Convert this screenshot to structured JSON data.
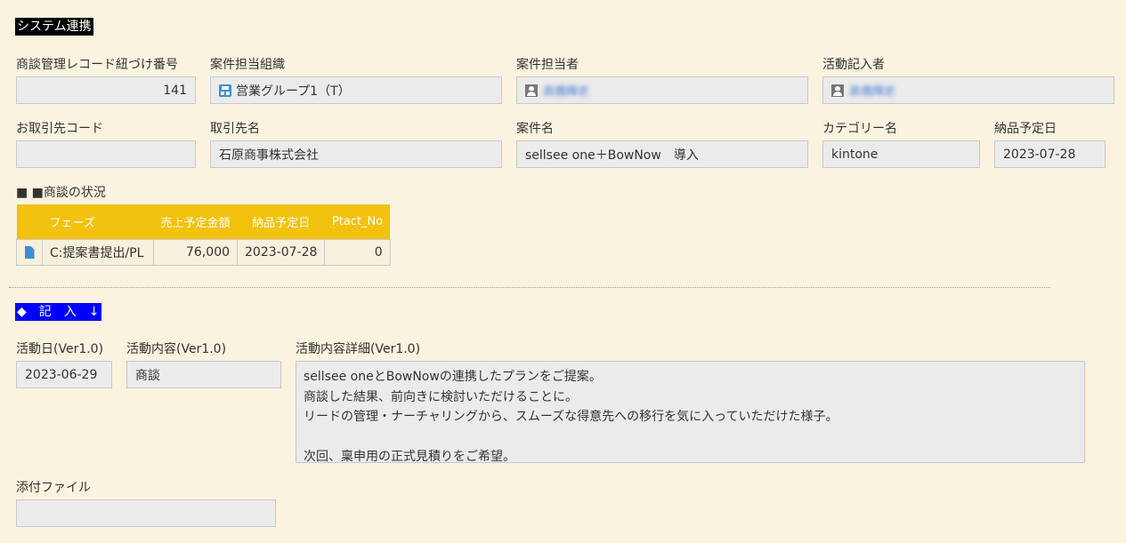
{
  "section_system": {
    "title": "システム連携",
    "bg": "#000000"
  },
  "fields": {
    "deal_record_no": {
      "label": "商談管理レコード紐づけ番号",
      "value": "141"
    },
    "org": {
      "label": "案件担当組織",
      "value": "営業グループ1（T）"
    },
    "owner": {
      "label": "案件担当者",
      "value": "高橋輝史"
    },
    "recorder": {
      "label": "活動記入者",
      "value": "高橋輝史"
    },
    "client_code": {
      "label": "お取引先コード",
      "value": ""
    },
    "client_name": {
      "label": "取引先名",
      "value": "石原商事株式会社"
    },
    "project_name": {
      "label": "案件名",
      "value": "sellsee one＋BowNow　導入"
    },
    "category": {
      "label": "カテゴリー名",
      "value": "kintone"
    },
    "delivery_date": {
      "label": "納品予定日",
      "value": "2023-07-28"
    }
  },
  "deal_status": {
    "title": "■ ■商談の状況",
    "header_color": "#f2c20f",
    "columns": [
      "フェーズ",
      "売上予定金額",
      "納品予定日",
      "Ptact_No"
    ],
    "rows": [
      {
        "icon": "document-icon",
        "phase": "C:提案書提出/PL",
        "amount": "76,000",
        "date": "2023-07-28",
        "ptact": "0"
      }
    ]
  },
  "section_entry": {
    "title": "◆　記　入　↓",
    "bg": "#0000ff"
  },
  "activity": {
    "date": {
      "label": "活動日(Ver1.0)",
      "value": "2023-06-29"
    },
    "content": {
      "label": "活動内容(Ver1.0)",
      "value": "商談"
    },
    "detail": {
      "label": "活動内容詳細(Ver1.0)",
      "lines": [
        "sellsee oneとBowNowの連携したプランをご提案。",
        "商談した結果、前向きに検討いただけることに。",
        "リードの管理・ナーチャリングから、スムーズな得意先への移行を気に入っていただけた様子。",
        "",
        "次回、稟申用の正式見積りをご希望。"
      ]
    }
  },
  "attachment": {
    "label": "添付ファイル",
    "value": ""
  }
}
